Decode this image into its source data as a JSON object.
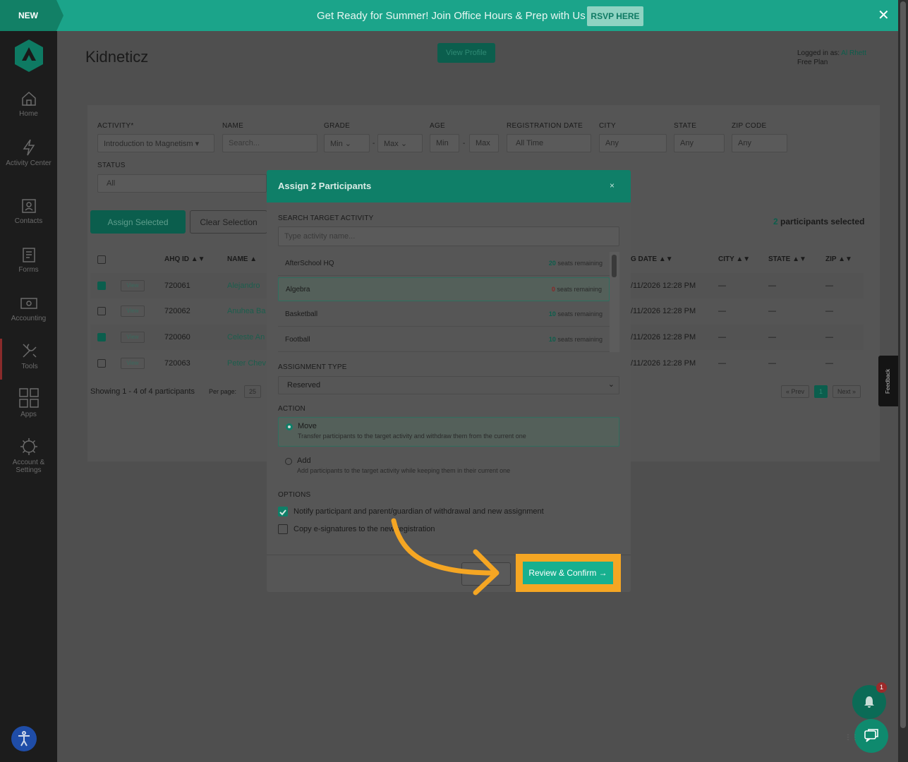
{
  "banner": {
    "badge": "NEW",
    "message": "Get Ready for Summer! Join Office Hours & Prep with Us",
    "cta": "RSVP HERE",
    "close": "✕"
  },
  "sidebar": {
    "items": [
      {
        "label": "Home",
        "icon": "home-icon"
      },
      {
        "label": "Activity Center",
        "icon": "lightning-icon"
      },
      {
        "label": "Contacts",
        "icon": "contacts-icon"
      },
      {
        "label": "Forms",
        "icon": "forms-icon"
      },
      {
        "label": "Accounting",
        "icon": "accounting-icon"
      },
      {
        "label": "Tools",
        "icon": "tools-icon"
      },
      {
        "label": "Apps",
        "icon": "apps-icon"
      },
      {
        "label": "Account & Settings",
        "icon": "gear-icon"
      }
    ]
  },
  "header": {
    "title": "Kidneticz",
    "view_profile": "View Profile",
    "logged_in_label": "Logged in as:",
    "user": "Al Rhett",
    "plan": "Free Plan"
  },
  "filters": {
    "activity_label": "ACTIVITY*",
    "activity_value": "Introduction to Magnetism",
    "name_label": "NAME",
    "name_placeholder": "Search...",
    "grade_label": "GRADE",
    "grade_min": "Min",
    "grade_max": "Max",
    "age_label": "AGE",
    "age_min": "Min",
    "age_max": "Max",
    "regdate_label": "REGISTRATION DATE",
    "regdate_value": "All Time",
    "city_label": "CITY",
    "city_value": "Any",
    "state_label": "STATE",
    "state_value": "Any",
    "zip_label": "ZIP CODE",
    "zip_value": "Any",
    "status_label": "STATUS",
    "status_value": "All",
    "dash": "-"
  },
  "actions": {
    "assign_selected": "Assign Selected",
    "clear_selection": "Clear Selection",
    "selected_count": "2",
    "selected_suffix": "participants selected"
  },
  "table": {
    "headers": {
      "ahq_id": "AHQ ID ▲▼",
      "name": "NAME ▲",
      "reg_date": "G DATE ▲▼",
      "city": "CITY ▲▼",
      "state": "STATE ▲▼",
      "zip": "ZIP ▲▼"
    },
    "rows": [
      {
        "view": "View",
        "id": "720061",
        "name": "Alejandro",
        "date": "/11/2026 12:28 PM",
        "city": "—",
        "state": "—",
        "zip": "—",
        "checked": true
      },
      {
        "view": "View",
        "id": "720062",
        "name": "Anuhea Ba",
        "date": "/11/2026 12:28 PM",
        "city": "—",
        "state": "—",
        "zip": "—",
        "checked": false
      },
      {
        "view": "View",
        "id": "720060",
        "name": "Celeste An",
        "date": "/11/2026 12:28 PM",
        "city": "—",
        "state": "—",
        "zip": "—",
        "checked": true
      },
      {
        "view": "View",
        "id": "720063",
        "name": "Peter Chev",
        "date": "/11/2026 12:28 PM",
        "city": "—",
        "state": "—",
        "zip": "—",
        "checked": false
      }
    ],
    "showing": "Showing 1 - 4 of 4 participants",
    "per_page_label": "Per page:",
    "per_page_value": "25",
    "prev": "« Prev",
    "page": "1",
    "next": "Next »"
  },
  "feedback": "Feedback",
  "modal": {
    "title": "Assign 2 Participants",
    "close": "×",
    "search_label": "SEARCH TARGET ACTIVITY",
    "search_placeholder": "Type activity name...",
    "activities": [
      {
        "name": "AfterSchool HQ",
        "seats": "20",
        "suffix": "seats remaining"
      },
      {
        "name": "Algebra",
        "seats": "0",
        "suffix": "seats remaining"
      },
      {
        "name": "Basketball",
        "seats": "10",
        "suffix": "seats remaining"
      },
      {
        "name": "Football",
        "seats": "10",
        "suffix": "seats remaining"
      }
    ],
    "assignment_type_label": "ASSIGNMENT TYPE",
    "assignment_type_value": "Reserved",
    "action_label": "ACTION",
    "move_title": "Move",
    "move_desc": "Transfer participants to the target activity and withdraw them from the current one",
    "add_title": "Add",
    "add_desc": "Add participants to the target activity while keeping them in their current one",
    "options_label": "OPTIONS",
    "opt_notify": "Notify participant and parent/guardian of withdrawal and new assignment",
    "opt_copy": "Copy e-signatures to the new registration",
    "confirm": "Review & Confirm →"
  },
  "notifications": {
    "badge": "1"
  },
  "colors": {
    "brand": "#1ba48a",
    "highlight": "#f5a623",
    "cta": "#17b08f"
  }
}
